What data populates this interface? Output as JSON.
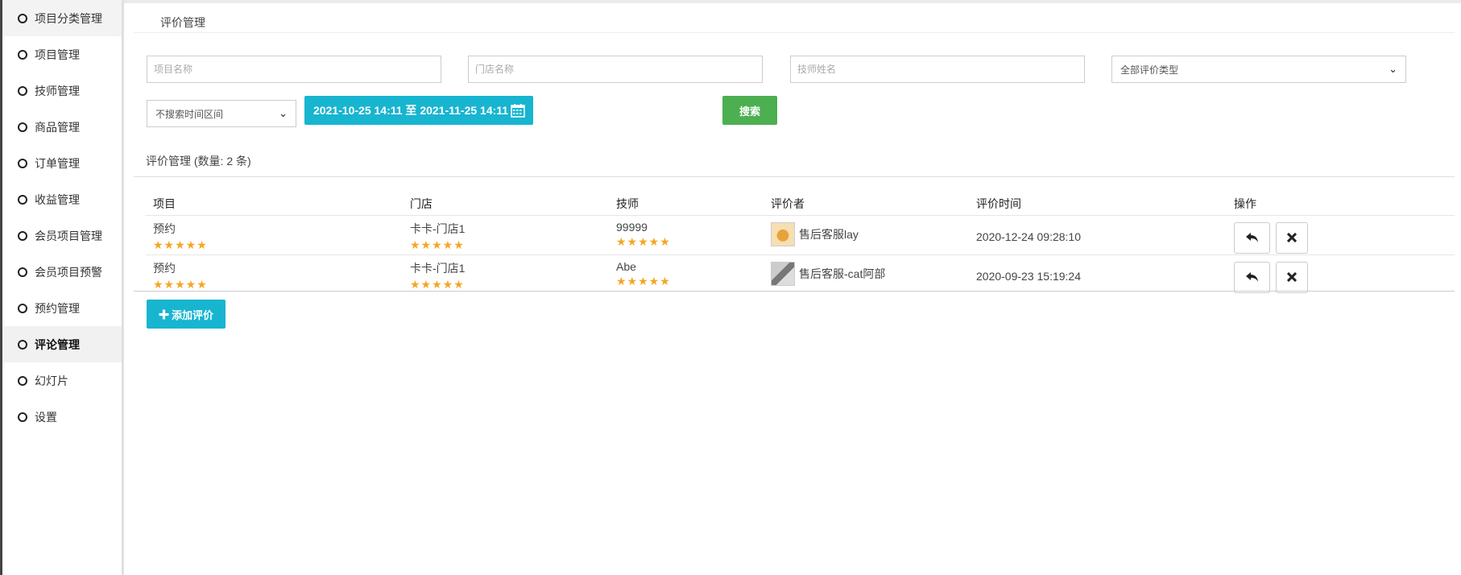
{
  "sidebar": {
    "items": [
      {
        "label": "项目分类管理"
      },
      {
        "label": "项目管理"
      },
      {
        "label": "技师管理"
      },
      {
        "label": "商品管理"
      },
      {
        "label": "订单管理"
      },
      {
        "label": "收益管理"
      },
      {
        "label": "会员项目管理"
      },
      {
        "label": "会员项目预警"
      },
      {
        "label": "预约管理"
      },
      {
        "label": "评论管理"
      },
      {
        "label": "幻灯片"
      },
      {
        "label": "设置"
      }
    ],
    "active_label": "评论管理"
  },
  "page": {
    "title": "评价管理"
  },
  "filters": {
    "project_placeholder": "项目名称",
    "store_placeholder": "门店名称",
    "tech_placeholder": "技师姓名",
    "type_select": "全部评价类型",
    "time_select": "不搜索时间区间",
    "date_range": "2021-10-25 14:11 至 2021-11-25 14:11",
    "search_label": "搜索"
  },
  "list": {
    "header": "评价管理 (数量: 2 条)",
    "columns": [
      "项目",
      "门店",
      "技师",
      "评价者",
      "评价时间",
      "操作"
    ],
    "rows": [
      {
        "project": "预约",
        "store": "卡卡-门店1",
        "tech": "99999",
        "reviewer": "售后客服lay",
        "time": "2020-12-24 09:28:10",
        "project_stars": 5,
        "store_stars": 5,
        "tech_stars": 5
      },
      {
        "project": "预约",
        "store": "卡卡-门店1",
        "tech": "Abe",
        "reviewer": "售后客服-cat阿部",
        "time": "2020-09-23 15:19:24",
        "project_stars": 5,
        "store_stars": 5,
        "tech_stars": 5
      }
    ]
  },
  "add_button_label": "添加评价",
  "colors": {
    "accent": "#17b5d0",
    "search": "#4caf50",
    "star": "#f5a623"
  }
}
